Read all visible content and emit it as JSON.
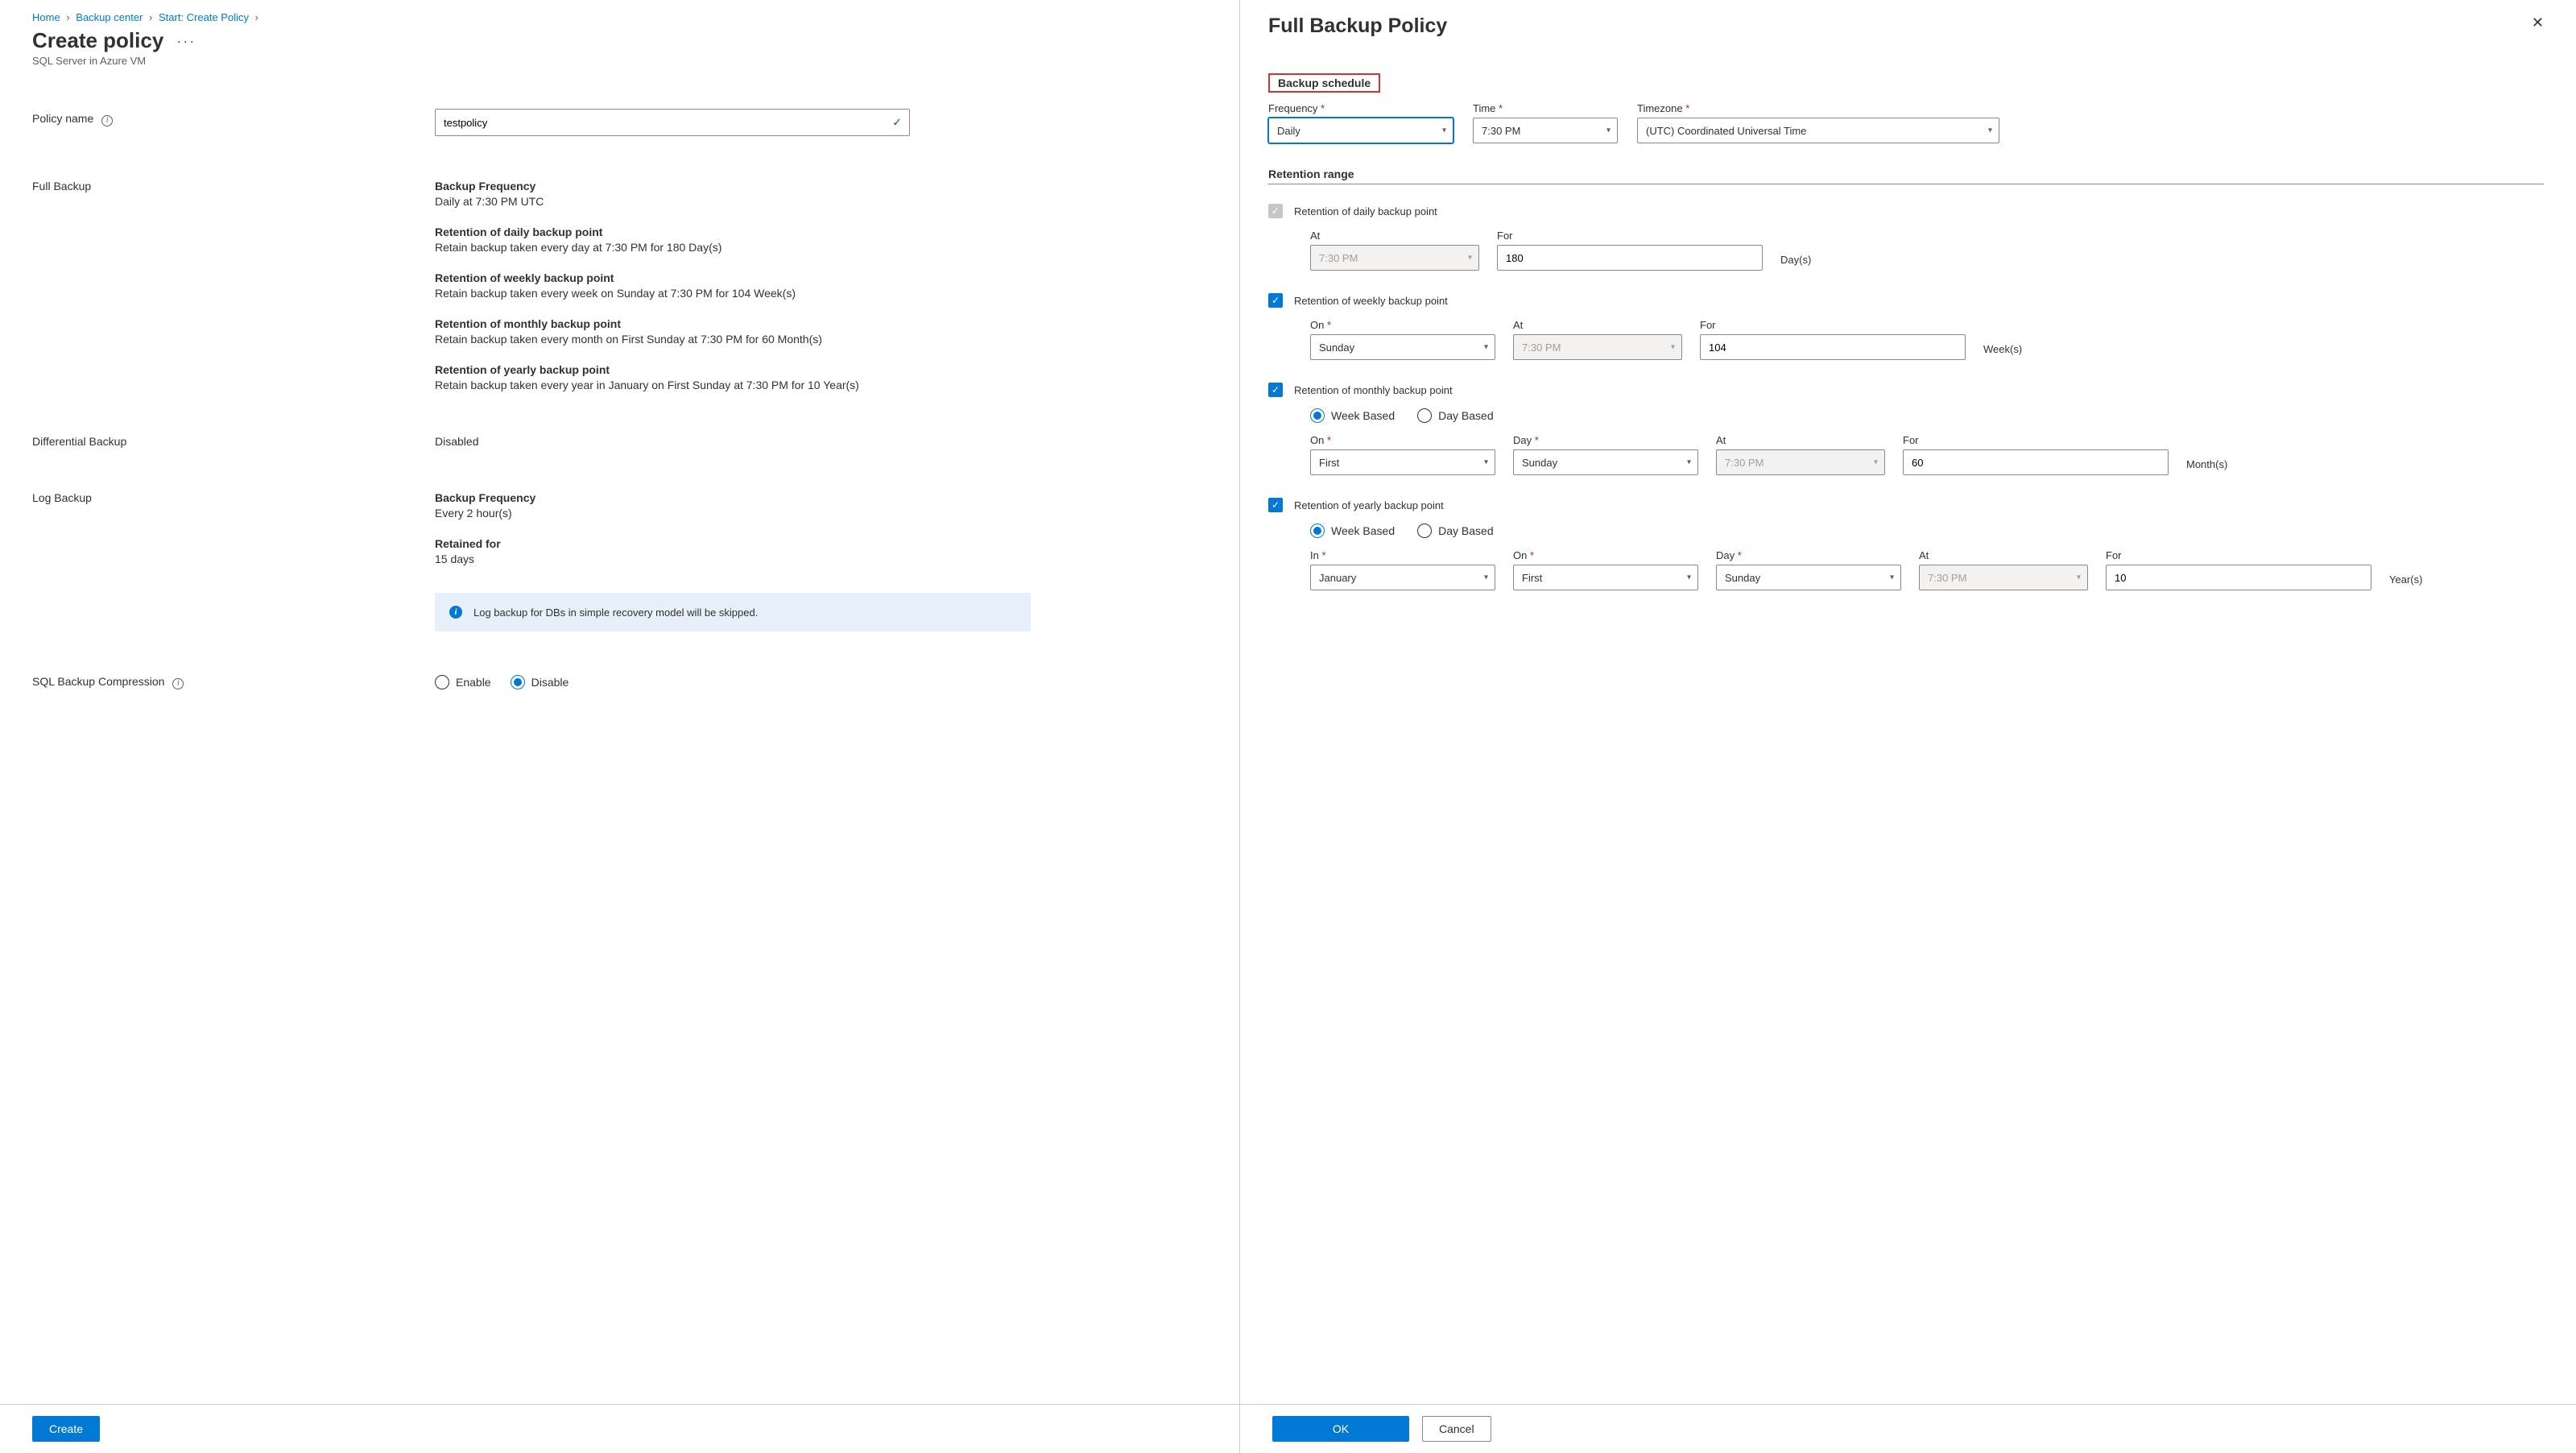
{
  "breadcrumb": {
    "home": "Home",
    "center": "Backup center",
    "start": "Start: Create Policy"
  },
  "left": {
    "title": "Create policy",
    "subtitle": "SQL Server in Azure VM",
    "policy_name_label": "Policy name",
    "policy_name_value": "testpolicy",
    "full_backup_label": "Full Backup",
    "full": {
      "bf_h": "Backup Frequency",
      "bf_v": "Daily at 7:30 PM UTC",
      "d_h": "Retention of daily backup point",
      "d_v": "Retain backup taken every day at 7:30 PM for 180 Day(s)",
      "w_h": "Retention of weekly backup point",
      "w_v": "Retain backup taken every week on Sunday at 7:30 PM for 104 Week(s)",
      "m_h": "Retention of monthly backup point",
      "m_v": "Retain backup taken every month on First Sunday at 7:30 PM for 60 Month(s)",
      "y_h": "Retention of yearly backup point",
      "y_v": "Retain backup taken every year in January on First Sunday at 7:30 PM for 10 Year(s)"
    },
    "diff_label": "Differential Backup",
    "diff_value": "Disabled",
    "log_label": "Log Backup",
    "log": {
      "bf_h": "Backup Frequency",
      "bf_v": "Every 2 hour(s)",
      "rf_h": "Retained for",
      "rf_v": "15 days"
    },
    "banner": "Log backup for DBs in simple recovery model will be skipped.",
    "comp_label": "SQL Backup Compression",
    "enable": "Enable",
    "disable": "Disable",
    "create_btn": "Create"
  },
  "right": {
    "title": "Full Backup Policy",
    "schedule_heading": "Backup schedule",
    "freq_label": "Frequency",
    "freq_value": "Daily",
    "time_label": "Time",
    "time_value": "7:30 PM",
    "tz_label": "Timezone",
    "tz_value": "(UTC) Coordinated Universal Time",
    "retention_heading": "Retention range",
    "daily": {
      "label": "Retention of daily backup point",
      "at": "At",
      "at_v": "7:30 PM",
      "for": "For",
      "for_v": "180",
      "unit": "Day(s)"
    },
    "weekly": {
      "label": "Retention of weekly backup point",
      "on": "On",
      "on_v": "Sunday",
      "at": "At",
      "at_v": "7:30 PM",
      "for": "For",
      "for_v": "104",
      "unit": "Week(s)"
    },
    "monthly": {
      "label": "Retention of monthly backup point",
      "wb": "Week Based",
      "db": "Day Based",
      "on": "On",
      "on_v": "First",
      "day": "Day",
      "day_v": "Sunday",
      "at": "At",
      "at_v": "7:30 PM",
      "for": "For",
      "for_v": "60",
      "unit": "Month(s)"
    },
    "yearly": {
      "label": "Retention of yearly backup point",
      "wb": "Week Based",
      "db": "Day Based",
      "in": "In",
      "in_v": "January",
      "on": "On",
      "on_v": "First",
      "day": "Day",
      "day_v": "Sunday",
      "at": "At",
      "at_v": "7:30 PM",
      "for": "For",
      "for_v": "10",
      "unit": "Year(s)"
    },
    "ok": "OK",
    "cancel": "Cancel"
  }
}
